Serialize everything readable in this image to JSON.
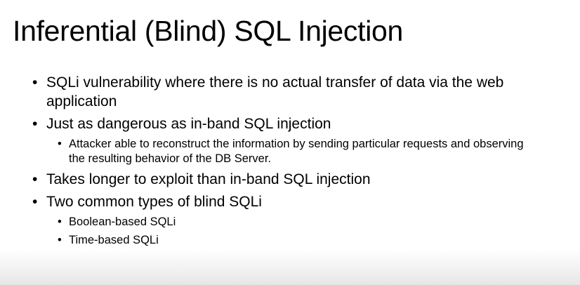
{
  "slide": {
    "title": "Inferential (Blind) SQL Injection",
    "bullets": [
      {
        "text": "SQLi vulnerability where there is no actual transfer of data via the web application",
        "sub": []
      },
      {
        "text": "Just as dangerous as in-band SQL injection",
        "sub": [
          "Attacker able to reconstruct the information by sending particular requests and observing the resulting behavior of the DB Server."
        ]
      },
      {
        "text": "Takes longer to exploit than in-band SQL injection",
        "sub": []
      },
      {
        "text": "Two common types of blind SQLi",
        "sub": [
          "Boolean-based SQLi",
          "Time-based SQLi"
        ]
      }
    ],
    "bullet_glyph": "•"
  }
}
